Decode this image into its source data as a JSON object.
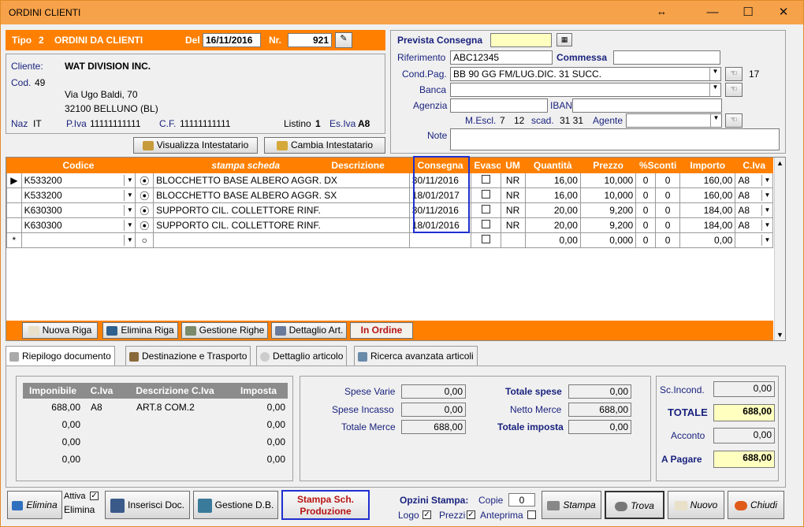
{
  "window": {
    "title": "ORDINI CLIENTI"
  },
  "colors": {
    "accent": "#ff8000",
    "highlight": "#1f2fd0",
    "yellow_field": "#ffffc0"
  },
  "header": {
    "tipo_label": "Tipo",
    "tipo_value": "2",
    "tipo_desc": "ORDINI DA CLIENTI",
    "del_label": "Del",
    "date": "16/11/2016",
    "nr_label": "Nr.",
    "nr": "921"
  },
  "cliente": {
    "label": "Cliente:",
    "name": "WAT DIVISION INC.",
    "cod_label": "Cod.",
    "cod": "49",
    "address1": "Via Ugo Baldi, 70",
    "address2": "32100 BELLUNO (BL)",
    "naz_label": "Naz",
    "naz": "IT",
    "piva_label": "P.Iva",
    "piva": "11111111111",
    "cf_label": "C.F.",
    "cf": "11111111111",
    "listino_label": "Listino",
    "listino": "1",
    "esiva_label": "Es.Iva",
    "esiva": "A8"
  },
  "buttons_top": {
    "visualizza": "Visualizza Intestatario",
    "cambia": "Cambia Intestatario"
  },
  "right_panel": {
    "prevista_label": "Prevista Consegna",
    "prevista_value": "",
    "riferimento_label": "Riferimento",
    "riferimento": "ABC12345",
    "commessa_label": "Commessa",
    "commessa": "",
    "condpag_label": "Cond.Pag.",
    "condpag": "BB 90 GG FM/LUG.DIC. 31 SUCC.",
    "condpag_num": "17",
    "banca_label": "Banca",
    "banca": "",
    "agenzia_label": "Agenzia",
    "agenzia": "",
    "iban_label": "IBAN",
    "iban": "",
    "mescl_label": "M.Escl.",
    "mescl_1": "7",
    "mescl_2": "12",
    "scad_label": "scad.",
    "scad": "31 31",
    "agente_label": "Agente",
    "agente": "",
    "note_label": "Note",
    "note": ""
  },
  "grid": {
    "headers": [
      "Codice",
      "stampa scheda",
      "Descrizione",
      "Consegna",
      "Evaso",
      "UM",
      "Quantità",
      "Prezzo",
      "%Sconti",
      "Importo",
      "C.Iva"
    ],
    "rows": [
      {
        "codice": "K533200",
        "descrizione": "BLOCCHETTO BASE ALBERO AGGR. DX",
        "consegna": "30/11/2016",
        "um": "NR",
        "quantita": "16,00",
        "prezzo": "10,000",
        "sc1": "0",
        "sc2": "0",
        "importo": "160,00",
        "civa": "A8"
      },
      {
        "codice": "K533200",
        "descrizione": "BLOCCHETTO BASE ALBERO AGGR. SX",
        "consegna": "18/01/2017",
        "um": "NR",
        "quantita": "16,00",
        "prezzo": "10,000",
        "sc1": "0",
        "sc2": "0",
        "importo": "160,00",
        "civa": "A8"
      },
      {
        "codice": "K630300",
        "descrizione": "SUPPORTO CIL. COLLETTORE RINF.",
        "consegna": "30/11/2016",
        "um": "NR",
        "quantita": "20,00",
        "prezzo": "9,200",
        "sc1": "0",
        "sc2": "0",
        "importo": "184,00",
        "civa": "A8"
      },
      {
        "codice": "K630300",
        "descrizione": "SUPPORTO CIL. COLLETTORE RINF.",
        "consegna": "18/01/2016",
        "um": "NR",
        "quantita": "20,00",
        "prezzo": "9,200",
        "sc1": "0",
        "sc2": "0",
        "importo": "184,00",
        "civa": "A8"
      }
    ],
    "new_row": {
      "marker": "*",
      "quantita": "0,00",
      "prezzo": "0,000",
      "sc1": "0",
      "sc2": "0",
      "importo": "0,00"
    }
  },
  "grid_buttons": {
    "nuova": "Nuova Riga",
    "elimina": "Elimina Riga",
    "gestione": "Gestione Righe",
    "dettaglio": "Dettaglio Art.",
    "inordine": "In Ordine"
  },
  "tabs": [
    "Riepilogo documento",
    "Destinazione e Trasporto",
    "Dettaglio articolo",
    "Ricerca avanzata articoli"
  ],
  "summary": {
    "headers": [
      "Imponibile",
      "C.Iva",
      "Descrizione C.Iva",
      "Imposta"
    ],
    "rows": [
      [
        "688,00",
        "A8",
        "ART.8 COM.2",
        "0,00"
      ],
      [
        "0,00",
        "",
        "",
        "0,00"
      ],
      [
        "0,00",
        "",
        "",
        "0,00"
      ],
      [
        "0,00",
        "",
        "",
        "0,00"
      ]
    ]
  },
  "totals": {
    "spese_varie_label": "Spese Varie",
    "spese_varie": "0,00",
    "spese_incasso_label": "Spese Incasso",
    "spese_incasso": "0,00",
    "totale_merce_label": "Totale Merce",
    "totale_merce": "688,00",
    "totale_spese_label": "Totale spese",
    "totale_spese": "0,00",
    "netto_merce_label": "Netto Merce",
    "netto_merce": "688,00",
    "totale_imposta_label": "Totale imposta",
    "totale_imposta": "0,00"
  },
  "final": {
    "scincond_label": "Sc.Incond.",
    "scincond": "0,00",
    "totale_label": "TOTALE",
    "totale": "688,00",
    "acconto_label": "Acconto",
    "acconto": "0,00",
    "apagare_label": "A Pagare",
    "apagare": "688,00"
  },
  "bottom": {
    "elimina": "Elimina",
    "attiva_label": "Attiva",
    "elimina_label": "Elimina",
    "inserisci": "Inserisci Doc.",
    "gestione_db": "Gestione D.B.",
    "stampa_sch_1": "Stampa Sch.",
    "stampa_sch_2": "Produzione",
    "opzioni_label": "Opzini Stampa:",
    "copie_label": "Copie",
    "copie": "0",
    "logo_label": "Logo",
    "prezzi_label": "Prezzi",
    "anteprima_label": "Anteprima",
    "stampa": "Stampa",
    "trova": "Trova",
    "nuovo": "Nuovo",
    "chiudi": "Chiudi"
  }
}
